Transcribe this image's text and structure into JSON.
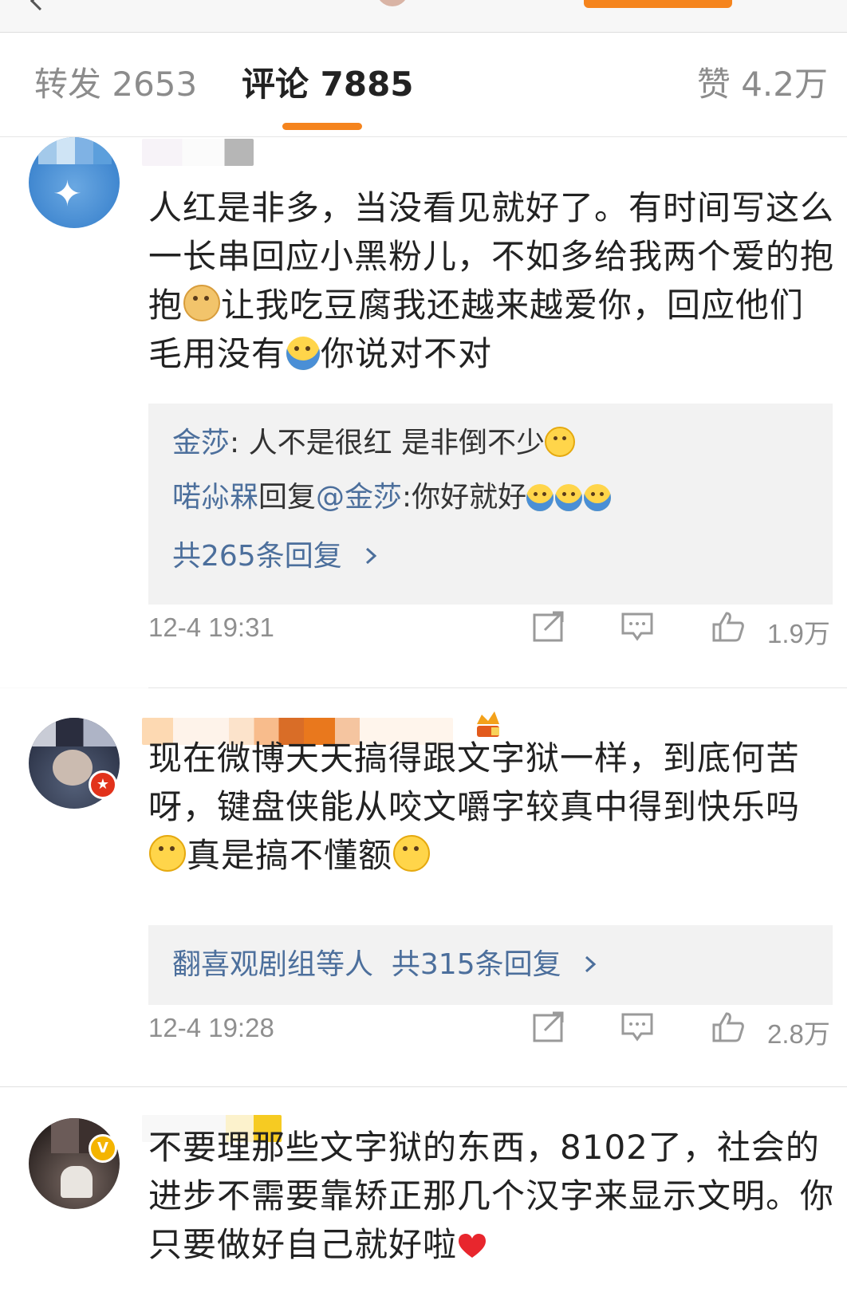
{
  "tabs": {
    "repost": "转发 2653",
    "comments": "评论 7885",
    "likes": "赞 4.2万"
  },
  "comments": [
    {
      "text_a": "人红是非多，当没看见就好了。有时间写这么一长串回应小黑粉儿，不如多给我两个爱的抱抱",
      "text_b": "让我吃豆腐我还越来越爱你，回应他们毛用没有",
      "text_c": "你说对不对",
      "replies": {
        "r1_name": "金莎",
        "r1_sep": ": ",
        "r1_text": "人不是很红 是非倒不少",
        "r2_name": "喏尛槑",
        "r2_mid": "回复",
        "r2_at": "@金莎",
        "r2_text": ":你好就好",
        "more": "共265条回复"
      },
      "time": "12-4 19:31",
      "likes": "1.9万"
    },
    {
      "text_a": "现在微博天天搞得跟文字狱一样，到底何苦呀，键盘侠能从咬文嚼字较真中得到快乐吗",
      "text_b": "真是搞不懂额",
      "replies": {
        "summary_name": "翻喜观剧组等人",
        "more": "共315条回复"
      },
      "time": "12-4 19:28",
      "likes": "2.8万"
    },
    {
      "text": "不要理那些文字狱的东西，8102了，社会的进步不需要靠矫正那几个汉字来显示文明。你只要做好自己就好啦"
    }
  ],
  "badges": {
    "yellow": "V"
  },
  "colors": {
    "accent": "#f5841d",
    "link": "#4c6f9c",
    "muted": "#8f8f8f"
  },
  "icons": [
    "share-icon",
    "reply-icon",
    "like-icon",
    "chevron-right-icon",
    "crown-icon"
  ]
}
